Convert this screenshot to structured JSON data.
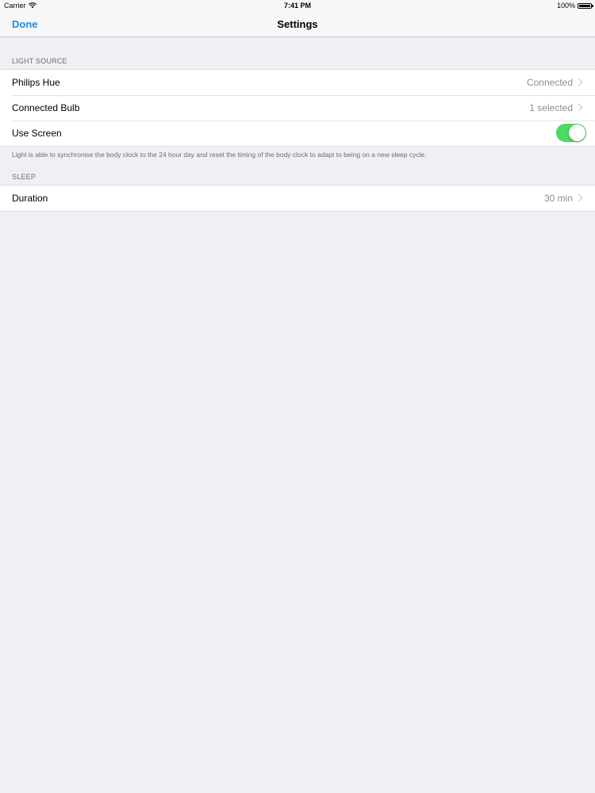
{
  "status_bar": {
    "carrier": "Carrier",
    "time": "7:41 PM",
    "battery_text": "100%",
    "battery_level": 1.0
  },
  "nav": {
    "done_label": "Done",
    "title": "Settings"
  },
  "light_source": {
    "header": "LIGHT SOURCE",
    "rows": [
      {
        "label": "Philips Hue",
        "value": "Connected"
      },
      {
        "label": "Connected Bulb",
        "value": "1 selected"
      },
      {
        "label": "Use Screen",
        "toggle_on": true
      }
    ],
    "footer": "Light is able to synchronise the body clock to the 24 hour day and reset the timing of the body clock to adapt to being on a new sleep cycle."
  },
  "sleep": {
    "header": "SLEEP",
    "rows": [
      {
        "label": "Duration",
        "value": "30 min"
      }
    ]
  },
  "colors": {
    "accent": "#1a8ee0",
    "toggle_on": "#4cd964",
    "background": "#efeff4"
  }
}
